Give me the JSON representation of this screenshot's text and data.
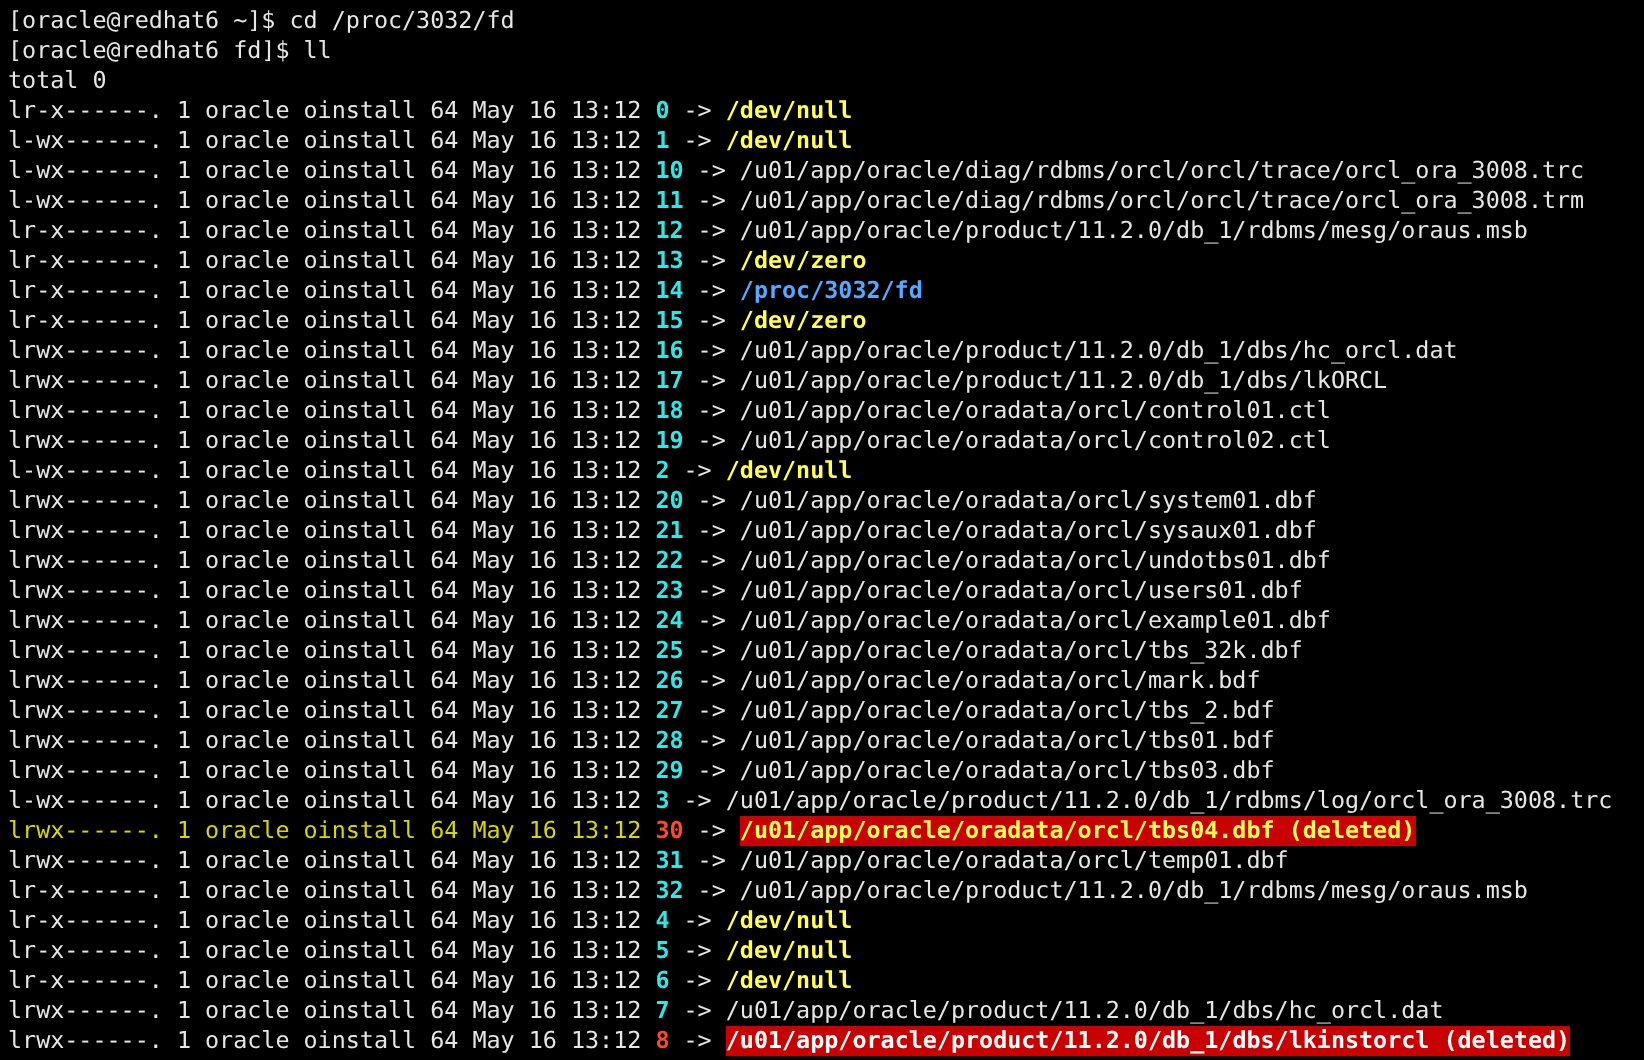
{
  "prompts": [
    {
      "text": "[oracle@redhat6 ~]$ cd /proc/3032/fd"
    },
    {
      "text": "[oracle@redhat6 fd]$ ll"
    }
  ],
  "total": "total 0",
  "rows": [
    {
      "info": "lr-x------. 1 oracle oinstall 64 May 16 13:12",
      "fd": "0",
      "arrow": "->",
      "target": "/dev/null",
      "kind": "device",
      "highlighted": false
    },
    {
      "info": "l-wx------. 1 oracle oinstall 64 May 16 13:12",
      "fd": "1",
      "arrow": "->",
      "target": "/dev/null",
      "kind": "device",
      "highlighted": false
    },
    {
      "info": "l-wx------. 1 oracle oinstall 64 May 16 13:12",
      "fd": "10",
      "arrow": "->",
      "target": "/u01/app/oracle/diag/rdbms/orcl/orcl/trace/orcl_ora_3008.trc",
      "kind": "file",
      "highlighted": false
    },
    {
      "info": "l-wx------. 1 oracle oinstall 64 May 16 13:12",
      "fd": "11",
      "arrow": "->",
      "target": "/u01/app/oracle/diag/rdbms/orcl/orcl/trace/orcl_ora_3008.trm",
      "kind": "file",
      "highlighted": false
    },
    {
      "info": "lr-x------. 1 oracle oinstall 64 May 16 13:12",
      "fd": "12",
      "arrow": "->",
      "target": "/u01/app/oracle/product/11.2.0/db_1/rdbms/mesg/oraus.msb",
      "kind": "file",
      "highlighted": false
    },
    {
      "info": "lr-x------. 1 oracle oinstall 64 May 16 13:12",
      "fd": "13",
      "arrow": "->",
      "target": "/dev/zero",
      "kind": "device",
      "highlighted": false
    },
    {
      "info": "lr-x------. 1 oracle oinstall 64 May 16 13:12",
      "fd": "14",
      "arrow": "->",
      "target": "/proc/3032/fd",
      "kind": "directory",
      "highlighted": false
    },
    {
      "info": "lr-x------. 1 oracle oinstall 64 May 16 13:12",
      "fd": "15",
      "arrow": "->",
      "target": "/dev/zero",
      "kind": "device",
      "highlighted": false
    },
    {
      "info": "lrwx------. 1 oracle oinstall 64 May 16 13:12",
      "fd": "16",
      "arrow": "->",
      "target": "/u01/app/oracle/product/11.2.0/db_1/dbs/hc_orcl.dat",
      "kind": "file",
      "highlighted": false
    },
    {
      "info": "lrwx------. 1 oracle oinstall 64 May 16 13:12",
      "fd": "17",
      "arrow": "->",
      "target": "/u01/app/oracle/product/11.2.0/db_1/dbs/lkORCL",
      "kind": "file",
      "highlighted": false
    },
    {
      "info": "lrwx------. 1 oracle oinstall 64 May 16 13:12",
      "fd": "18",
      "arrow": "->",
      "target": "/u01/app/oracle/oradata/orcl/control01.ctl",
      "kind": "file",
      "highlighted": false
    },
    {
      "info": "lrwx------. 1 oracle oinstall 64 May 16 13:12",
      "fd": "19",
      "arrow": "->",
      "target": "/u01/app/oracle/oradata/orcl/control02.ctl",
      "kind": "file",
      "highlighted": false
    },
    {
      "info": "l-wx------. 1 oracle oinstall 64 May 16 13:12",
      "fd": "2",
      "arrow": "->",
      "target": "/dev/null",
      "kind": "device",
      "highlighted": false
    },
    {
      "info": "lrwx------. 1 oracle oinstall 64 May 16 13:12",
      "fd": "20",
      "arrow": "->",
      "target": "/u01/app/oracle/oradata/orcl/system01.dbf",
      "kind": "file",
      "highlighted": false
    },
    {
      "info": "lrwx------. 1 oracle oinstall 64 May 16 13:12",
      "fd": "21",
      "arrow": "->",
      "target": "/u01/app/oracle/oradata/orcl/sysaux01.dbf",
      "kind": "file",
      "highlighted": false
    },
    {
      "info": "lrwx------. 1 oracle oinstall 64 May 16 13:12",
      "fd": "22",
      "arrow": "->",
      "target": "/u01/app/oracle/oradata/orcl/undotbs01.dbf",
      "kind": "file",
      "highlighted": false
    },
    {
      "info": "lrwx------. 1 oracle oinstall 64 May 16 13:12",
      "fd": "23",
      "arrow": "->",
      "target": "/u01/app/oracle/oradata/orcl/users01.dbf",
      "kind": "file",
      "highlighted": false
    },
    {
      "info": "lrwx------. 1 oracle oinstall 64 May 16 13:12",
      "fd": "24",
      "arrow": "->",
      "target": "/u01/app/oracle/oradata/orcl/example01.dbf",
      "kind": "file",
      "highlighted": false
    },
    {
      "info": "lrwx------. 1 oracle oinstall 64 May 16 13:12",
      "fd": "25",
      "arrow": "->",
      "target": "/u01/app/oracle/oradata/orcl/tbs_32k.dbf",
      "kind": "file",
      "highlighted": false
    },
    {
      "info": "lrwx------. 1 oracle oinstall 64 May 16 13:12",
      "fd": "26",
      "arrow": "->",
      "target": "/u01/app/oracle/oradata/orcl/mark.bdf",
      "kind": "file",
      "highlighted": false
    },
    {
      "info": "lrwx------. 1 oracle oinstall 64 May 16 13:12",
      "fd": "27",
      "arrow": "->",
      "target": "/u01/app/oracle/oradata/orcl/tbs_2.bdf",
      "kind": "file",
      "highlighted": false
    },
    {
      "info": "lrwx------. 1 oracle oinstall 64 May 16 13:12",
      "fd": "28",
      "arrow": "->",
      "target": "/u01/app/oracle/oradata/orcl/tbs01.bdf",
      "kind": "file",
      "highlighted": false
    },
    {
      "info": "lrwx------. 1 oracle oinstall 64 May 16 13:12",
      "fd": "29",
      "arrow": "->",
      "target": "/u01/app/oracle/oradata/orcl/tbs03.dbf",
      "kind": "file",
      "highlighted": false
    },
    {
      "info": "l-wx------. 1 oracle oinstall 64 May 16 13:12",
      "fd": "3",
      "arrow": "->",
      "target": "/u01/app/oracle/product/11.2.0/db_1/rdbms/log/orcl_ora_3008.trc",
      "kind": "file",
      "highlighted": false
    },
    {
      "info": "lrwx------. 1 oracle oinstall 64 May 16 13:12",
      "fd": "30",
      "arrow": "->",
      "target": "/u01/app/oracle/oradata/orcl/tbs04.dbf (deleted)",
      "kind": "deleted",
      "highlighted": true
    },
    {
      "info": "lrwx------. 1 oracle oinstall 64 May 16 13:12",
      "fd": "31",
      "arrow": "->",
      "target": "/u01/app/oracle/oradata/orcl/temp01.dbf",
      "kind": "file",
      "highlighted": false
    },
    {
      "info": "lr-x------. 1 oracle oinstall 64 May 16 13:12",
      "fd": "32",
      "arrow": "->",
      "target": "/u01/app/oracle/product/11.2.0/db_1/rdbms/mesg/oraus.msb",
      "kind": "file",
      "highlighted": false
    },
    {
      "info": "lr-x------. 1 oracle oinstall 64 May 16 13:12",
      "fd": "4",
      "arrow": "->",
      "target": "/dev/null",
      "kind": "device",
      "highlighted": false
    },
    {
      "info": "lr-x------. 1 oracle oinstall 64 May 16 13:12",
      "fd": "5",
      "arrow": "->",
      "target": "/dev/null",
      "kind": "device",
      "highlighted": false
    },
    {
      "info": "lr-x------. 1 oracle oinstall 64 May 16 13:12",
      "fd": "6",
      "arrow": "->",
      "target": "/dev/null",
      "kind": "device",
      "highlighted": false
    },
    {
      "info": "lrwx------. 1 oracle oinstall 64 May 16 13:12",
      "fd": "7",
      "arrow": "->",
      "target": "/u01/app/oracle/product/11.2.0/db_1/dbs/hc_orcl.dat",
      "kind": "file",
      "highlighted": false
    },
    {
      "info": "lrwx------. 1 oracle oinstall 64 May 16 13:12",
      "fd": "8",
      "arrow": "->",
      "target": "/u01/app/oracle/product/11.2.0/db_1/dbs/lkinstorcl (deleted)",
      "kind": "deleted",
      "highlighted": false
    }
  ]
}
